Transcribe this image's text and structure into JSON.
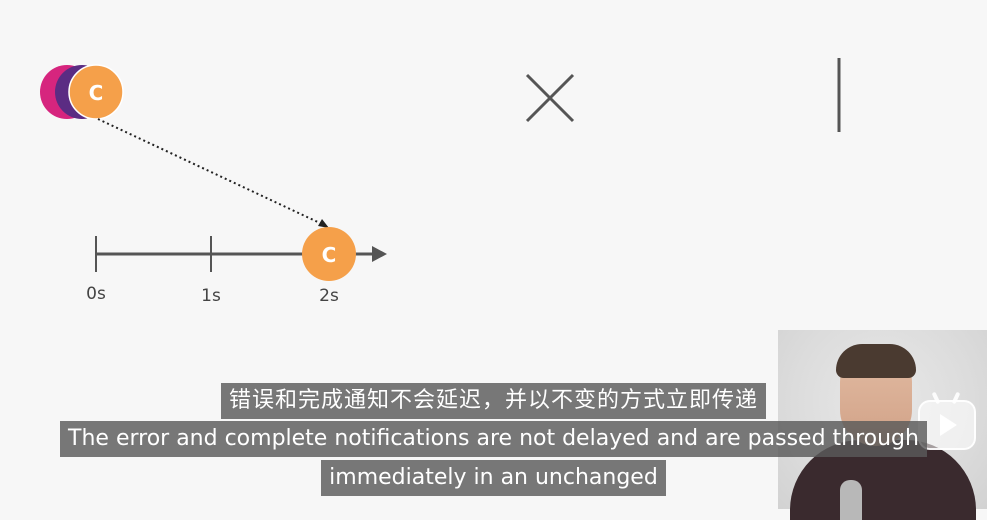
{
  "diagram": {
    "marble_label": "C",
    "timeline_ticks": [
      "0s",
      "1s",
      "2s"
    ]
  },
  "subtitles": {
    "zh": "错误和完成通知不会延迟，并以不变的方式立即传递",
    "en_line1": "The error and complete notifications are not delayed and are passed through",
    "en_line2": "immediately in an unchanged"
  },
  "colors": {
    "marble_orange": "#F5A04A",
    "marble_purple": "#5B2C83",
    "marble_pink": "#D6257E",
    "line": "#555555",
    "subtitle_bg": "#5a5a5a"
  },
  "icons": {
    "error_mark": "x-cross-icon",
    "complete_mark": "vertical-bar-icon",
    "watermark_logo": "play-tv-icon"
  }
}
